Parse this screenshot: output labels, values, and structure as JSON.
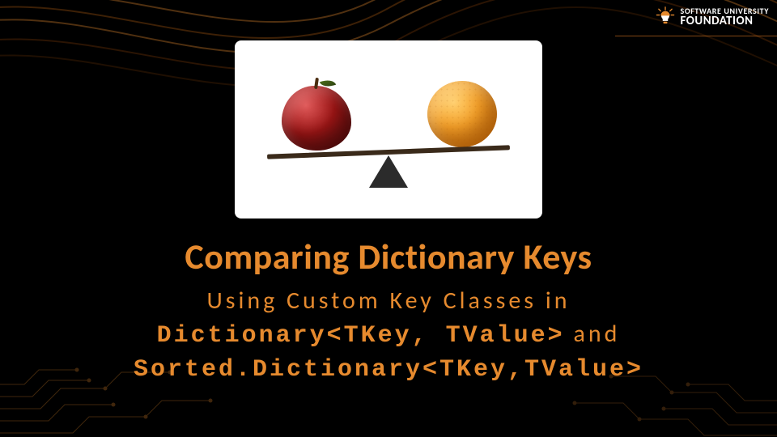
{
  "logo": {
    "top": "SOFTWARE UNIVERSITY",
    "bottom": "FOUNDATION"
  },
  "hero": {
    "left_item": "apple",
    "right_item": "orange"
  },
  "title": "Comparing Dictionary Keys",
  "subtitle": {
    "line1": "Using Custom Key Classes in",
    "mono1": "Dictionary<TKey, TValue>",
    "join": " and",
    "mono2": "Sorted.Dictionary<TKey,TValue>"
  },
  "colors": {
    "accent": "#e68a2e",
    "bg": "#000000"
  }
}
